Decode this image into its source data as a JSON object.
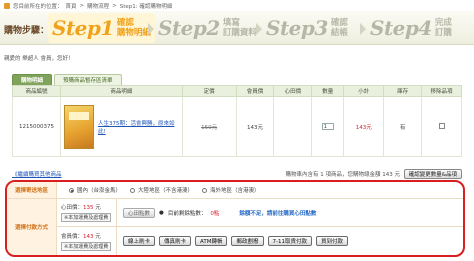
{
  "breadcrumb": {
    "prefix": "您目前所在的位置：",
    "items": [
      "首頁",
      "購物流程",
      "Step1: 確認購物明細"
    ]
  },
  "steps": {
    "title": "購物步驟：",
    "items": [
      {
        "big": "Step1",
        "line1": "確認",
        "line2": "購物明細"
      },
      {
        "big": "Step2",
        "line1": "填寫",
        "line2": "訂購資料"
      },
      {
        "big": "Step3",
        "line1": "確認",
        "line2": "結帳"
      },
      {
        "big": "Step4",
        "line1": "完成",
        "line2": "訂購"
      }
    ]
  },
  "greeting": "親愛的 樂超人 會員，您好！",
  "tabs": [
    "購物明細",
    "預購商品暫存區清單"
  ],
  "table": {
    "headers": [
      "商品編號",
      "商品明細",
      "定價",
      "會員價",
      "心田價",
      "數量",
      "小計",
      "庫存",
      "移除品項"
    ],
    "rows": [
      {
        "id": "1215000375",
        "title": "人生375期：活會興勝，原來如此!",
        "list_price": "150元",
        "member_price": "143元",
        "heart_price": "",
        "qty": "1",
        "subtotal": "143元",
        "stock": "有"
      }
    ]
  },
  "summary": {
    "continue_link": "《繼續購買其他商品",
    "total_text": "購物車內含有 1 項商品，您購物總金額 143 元",
    "recalc_button": "確認變更數量&品項"
  },
  "shipping": {
    "label": "選擇寄送地區",
    "options": [
      {
        "text": "國內（台澎金馬）",
        "selected": true
      },
      {
        "text": "大陸地區（不含港澳）",
        "selected": false
      },
      {
        "text": "海外地區（含港澳）",
        "selected": false
      }
    ]
  },
  "payment": {
    "label": "選擇付款方式",
    "heart_row": {
      "price_label": "心田價：",
      "price_value": "135",
      "price_unit": "元",
      "note": "※本加運費及處理費",
      "points_button": "心田點數",
      "points_text": "目前剩餘點數：",
      "points_value": "0點",
      "warn": "餘額不足，請前往購買心田點數"
    },
    "member_row": {
      "price_label": "會員價：",
      "price_value": "143",
      "price_unit": "元",
      "note": "※本加運費及處理費",
      "buttons": [
        "線上刷卡",
        "傳真刷卡",
        "ATM轉帳",
        "郵政劃撥",
        "7-11取貨付款",
        "貨到付款"
      ]
    }
  }
}
